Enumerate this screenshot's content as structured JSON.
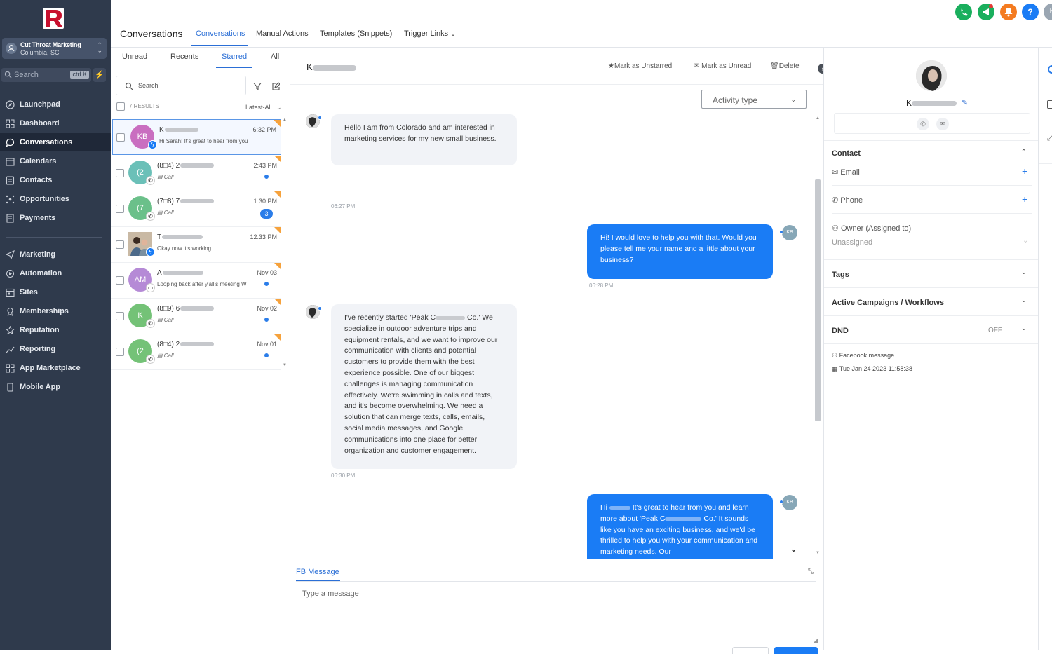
{
  "sidebar": {
    "account": {
      "name": "Cut Throat Marketing",
      "location": "Columbia, SC"
    },
    "search": {
      "placeholder": "Search",
      "shortcut": "ctrl K"
    },
    "items": [
      {
        "label": "Launchpad",
        "icon": "rocket-icon"
      },
      {
        "label": "Dashboard",
        "icon": "grid-icon"
      },
      {
        "label": "Conversations",
        "icon": "chat-icon",
        "active": true
      },
      {
        "label": "Calendars",
        "icon": "calendar-icon"
      },
      {
        "label": "Contacts",
        "icon": "contacts-icon"
      },
      {
        "label": "Opportunities",
        "icon": "opportunities-icon"
      },
      {
        "label": "Payments",
        "icon": "payments-icon"
      },
      {
        "label": "Marketing",
        "icon": "send-icon"
      },
      {
        "label": "Automation",
        "icon": "automation-icon"
      },
      {
        "label": "Sites",
        "icon": "sites-icon"
      },
      {
        "label": "Memberships",
        "icon": "memberships-icon"
      },
      {
        "label": "Reputation",
        "icon": "star-icon"
      },
      {
        "label": "Reporting",
        "icon": "reporting-icon"
      },
      {
        "label": "App Marketplace",
        "icon": "marketplace-icon"
      },
      {
        "label": "Mobile App",
        "icon": "mobile-icon"
      }
    ]
  },
  "header": {
    "title": "Conversations",
    "tabs": [
      "Conversations",
      "Manual Actions",
      "Templates (Snippets)",
      "Trigger Links"
    ],
    "active_tab": "Conversations",
    "icons": {
      "phone": "#1aaf5d",
      "announce": "#1aaf5d",
      "bell": "#f47b20",
      "help": "#1a7cf5",
      "user": "#9aa6b2"
    },
    "help_label": "?",
    "user_initial": "K"
  },
  "list": {
    "tabs": [
      "Unread",
      "Recents",
      "Starred",
      "All"
    ],
    "active_tab": "Starred",
    "search_placeholder": "Search",
    "results": "7 RESULTS",
    "sort": "Latest-All",
    "items": [
      {
        "initials": "KB",
        "name": "K",
        "preview": "Hi Sarah! It's great to hear from you",
        "time": "6:32 PM",
        "color": "#c96ec0",
        "channel": "messenger"
      },
      {
        "initials": "(2",
        "name": "(8□4) 2",
        "preview": "Call",
        "time": "2:43 PM",
        "color": "#6bc0b8",
        "channel": "call",
        "unread": "dot"
      },
      {
        "initials": "(7",
        "name": "(7□8) 7",
        "preview": "Call",
        "time": "1:30 PM",
        "color": "#6bc08a",
        "channel": "call",
        "unread": "3"
      },
      {
        "initials": "",
        "name": "T",
        "preview": "Okay now it's working",
        "time": "12:33 PM",
        "color": "#8a6f5a",
        "channel": "messenger"
      },
      {
        "initials": "AM",
        "name": "A",
        "preview": "Looping back after y'all's meeting W",
        "time": "Nov 03",
        "color": "#b58ad6",
        "channel": "sms",
        "unread": "dot"
      },
      {
        "initials": "K",
        "name": "(8□9) 6",
        "preview": "Call",
        "time": "Nov 02",
        "color": "#74c277",
        "channel": "call",
        "unread": "dot"
      },
      {
        "initials": "(2",
        "name": "(8□4) 2",
        "preview": "Call",
        "time": "Nov 01",
        "color": "#74c277",
        "channel": "call",
        "unread": "dot"
      }
    ]
  },
  "chat": {
    "contact_name": "K",
    "actions": {
      "unstar": "Mark as Unstarred",
      "unread": "Mark as Unread",
      "delete": "Delete"
    },
    "activity_type": "Activity type",
    "messages": [
      {
        "dir": "in",
        "text": "Hello I am from Colorado and am interested in marketing services for my new small business.",
        "time": "06:27 PM"
      },
      {
        "dir": "out",
        "text": "Hi! I would love to help you with that. Would you please tell me your name and a little about your business?",
        "time": "06:28 PM",
        "avatar": "KB"
      },
      {
        "dir": "in",
        "text_a": "I've recently started 'Peak C",
        "text_b": " Co.' We specialize in outdoor adventure trips and equipment rentals, and we want to improve our communication with clients and potential customers to provide them with the best experience possible. One of our biggest challenges is managing communication effectively. We're swimming in calls and texts, and it's become overwhelming. We need a solution that can merge texts, calls, emails, social media messages, and Google communications into one place for better organization and customer engagement.",
        "time": "06:30 PM"
      },
      {
        "dir": "out",
        "text_a": "Hi ",
        "text_b": " It's great to hear from you and learn more about 'Peak C",
        "text_c": " Co.' It sounds like you have an exciting business, and we'd be thrilled to help you with your communication and marketing needs. Our",
        "avatar": "KB"
      }
    ],
    "composer": {
      "tab": "FB Message",
      "placeholder": "Type a message"
    }
  },
  "contact": {
    "name": "K",
    "sections": {
      "contact": "Contact",
      "email": "Email",
      "phone": "Phone",
      "owner": "Owner (Assigned to)",
      "owner_value": "Unassigned",
      "tags": "Tags",
      "campaigns": "Active Campaigns / Workflows",
      "dnd": "DND",
      "dnd_value": "OFF"
    },
    "source": "Facebook message",
    "created": "Tue Jan 24 2023 11:58:38"
  },
  "colors": {
    "accent": "#2b6fd6",
    "sidebar": "#2f3a4c",
    "bubble_out": "#1a7cf5",
    "bubble_in": "#f1f3f7"
  }
}
